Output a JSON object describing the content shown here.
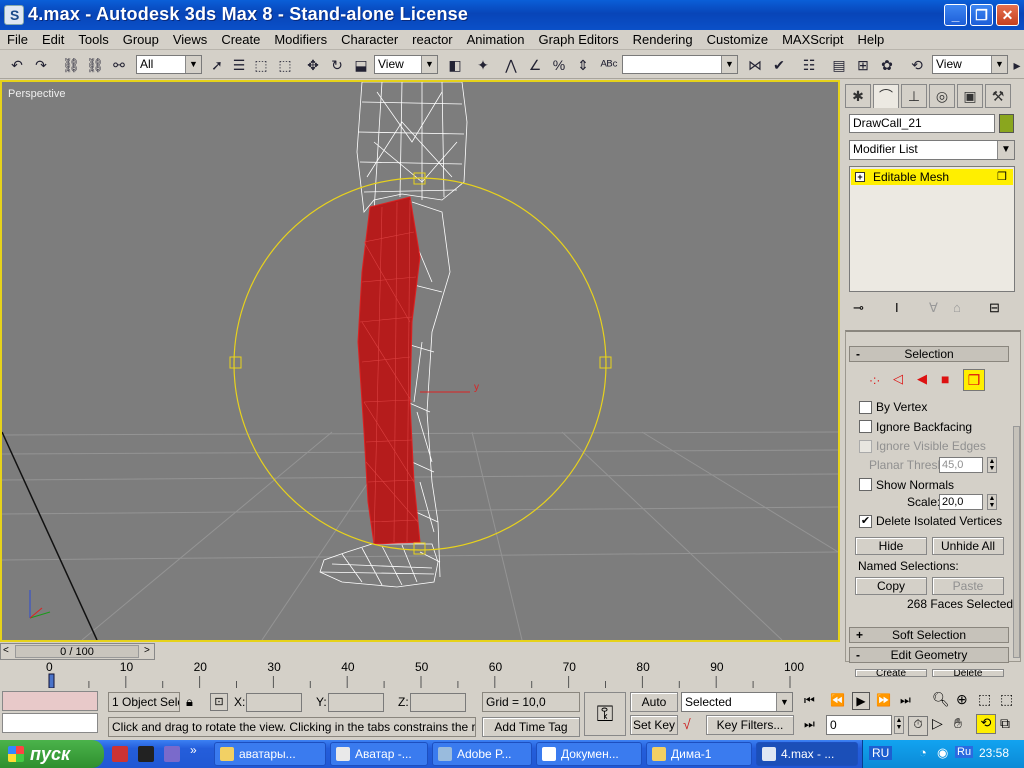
{
  "window": {
    "title": "4.max - Autodesk 3ds Max 8  - Stand-alone License"
  },
  "menu": [
    "File",
    "Edit",
    "Tools",
    "Group",
    "Views",
    "Create",
    "Modifiers",
    "Character",
    "reactor",
    "Animation",
    "Graph Editors",
    "Rendering",
    "Customize",
    "MAXScript",
    "Help"
  ],
  "toolbar": {
    "selection_filter": "All",
    "ref_coord": "View",
    "named_set": "",
    "view_right": "View"
  },
  "viewport": {
    "label": "Perspective",
    "axis_y": "y"
  },
  "panel": {
    "object_name": "DrawCall_21",
    "object_color": "#8aa61e",
    "modifier_list": "Modifier List",
    "stack_item": "Editable Mesh",
    "selection": {
      "header": "Selection",
      "by_vertex": "By Vertex",
      "ignore_backfacing": "Ignore Backfacing",
      "ignore_visible_edges": "Ignore Visible Edges",
      "planar_thresh_label": "Planar Thresh:",
      "planar_thresh_value": "45,0",
      "show_normals": "Show Normals",
      "scale_label": "Scale:",
      "scale_value": "20,0",
      "delete_isolated": "Delete Isolated Vertices",
      "hide": "Hide",
      "unhide_all": "Unhide All",
      "named_selections": "Named Selections:",
      "copy": "Copy",
      "paste": "Paste",
      "faces_selected": "268 Faces Selected"
    },
    "soft_selection": "Soft Selection",
    "edit_geometry": "Edit Geometry",
    "create": "Create",
    "delete": "Delete"
  },
  "trackbar": {
    "frame_counter": "0 / 100",
    "ticks": [
      "0",
      "10",
      "20",
      "30",
      "40",
      "50",
      "60",
      "70",
      "80",
      "90",
      "100"
    ]
  },
  "status": {
    "objects": "1 Object Sele",
    "x_label": "X:",
    "y_label": "Y:",
    "z_label": "Z:",
    "grid": "Grid = 10,0",
    "auto_key": "Auto Key",
    "set_key": "Set Key",
    "key_mode": "Selected",
    "key_filters": "Key Filters...",
    "frame": "0",
    "prompt": "Click and drag to rotate the view.  Clicking in the tabs constrains the rotation",
    "add_time_tag": "Add Time Tag"
  },
  "taskbar": {
    "start": "пуск",
    "tasks": [
      "аватары...",
      "Аватар -...",
      "Adobe P...",
      "Докумен...",
      "Дима-1",
      "4.max - ..."
    ],
    "lang": "RU",
    "tray_lang": "Ru",
    "clock": "23:58"
  }
}
